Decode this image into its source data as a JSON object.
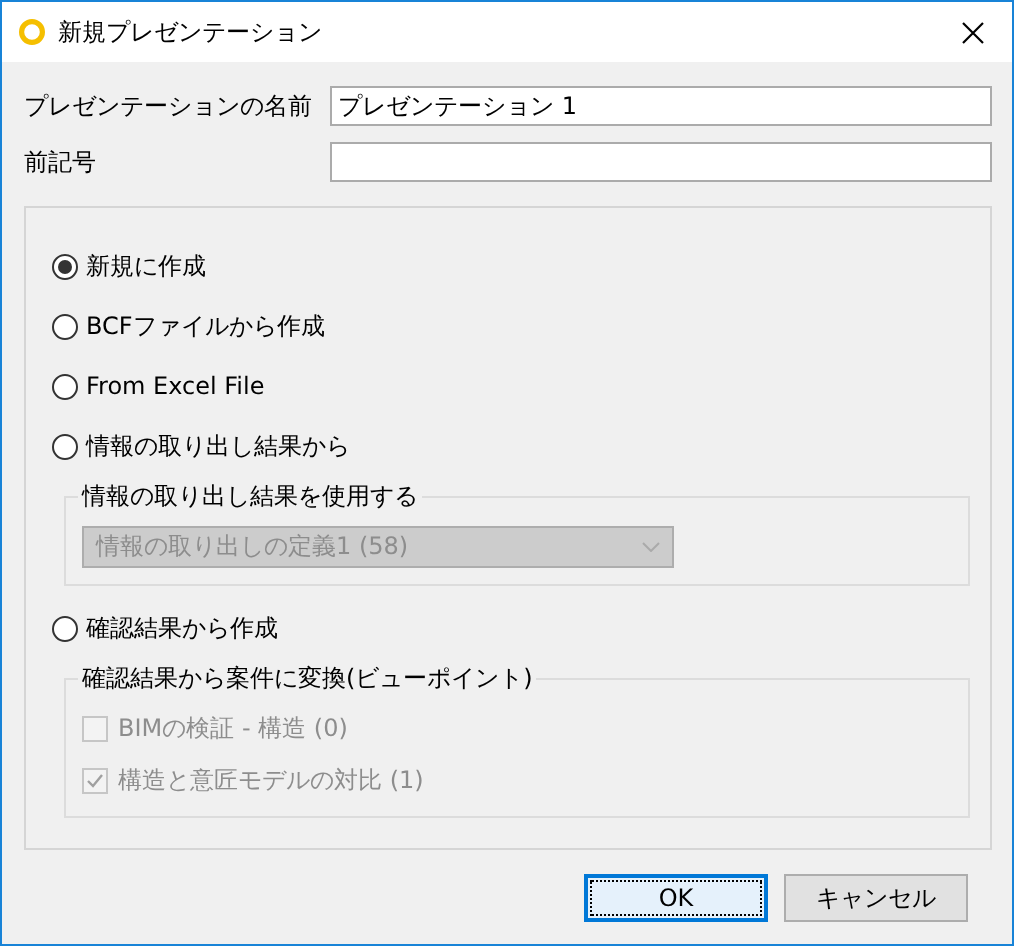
{
  "window": {
    "title": "新規プレゼンテーション"
  },
  "fields": [
    {
      "label": "プレゼンテーションの名前",
      "value": "プレゼンテーション 1"
    },
    {
      "label": "前記号"
    }
  ],
  "options": [
    {
      "kind": "radio",
      "label": "新規に作成",
      "selected": true
    },
    {
      "kind": "radio",
      "label": "BCFファイルから作成",
      "selected": false
    },
    {
      "kind": "radio",
      "label": "From Excel File",
      "selected": false
    },
    {
      "kind": "radio",
      "label": "情報の取り出し結果から",
      "selected": false
    },
    {
      "kind": "group",
      "title": "情報の取り出し結果を使用する",
      "disabled": true,
      "dropdown": {
        "value": "情報の取り出しの定義1 (58)"
      }
    },
    {
      "kind": "radio",
      "label": "確認結果から作成",
      "selected": false
    },
    {
      "kind": "group",
      "title": "確認結果から案件に変換(ビューポイント)",
      "disabled": true,
      "checks": [
        {
          "label": "BIMの検証 - 構造 (0)",
          "checked": false
        },
        {
          "label": "構造と意匠モデルの対比 (1)",
          "checked": true
        }
      ]
    }
  ],
  "buttons": [
    {
      "label": "OK",
      "selected": true
    },
    {
      "label": "キャンセル",
      "selected": false
    }
  ]
}
